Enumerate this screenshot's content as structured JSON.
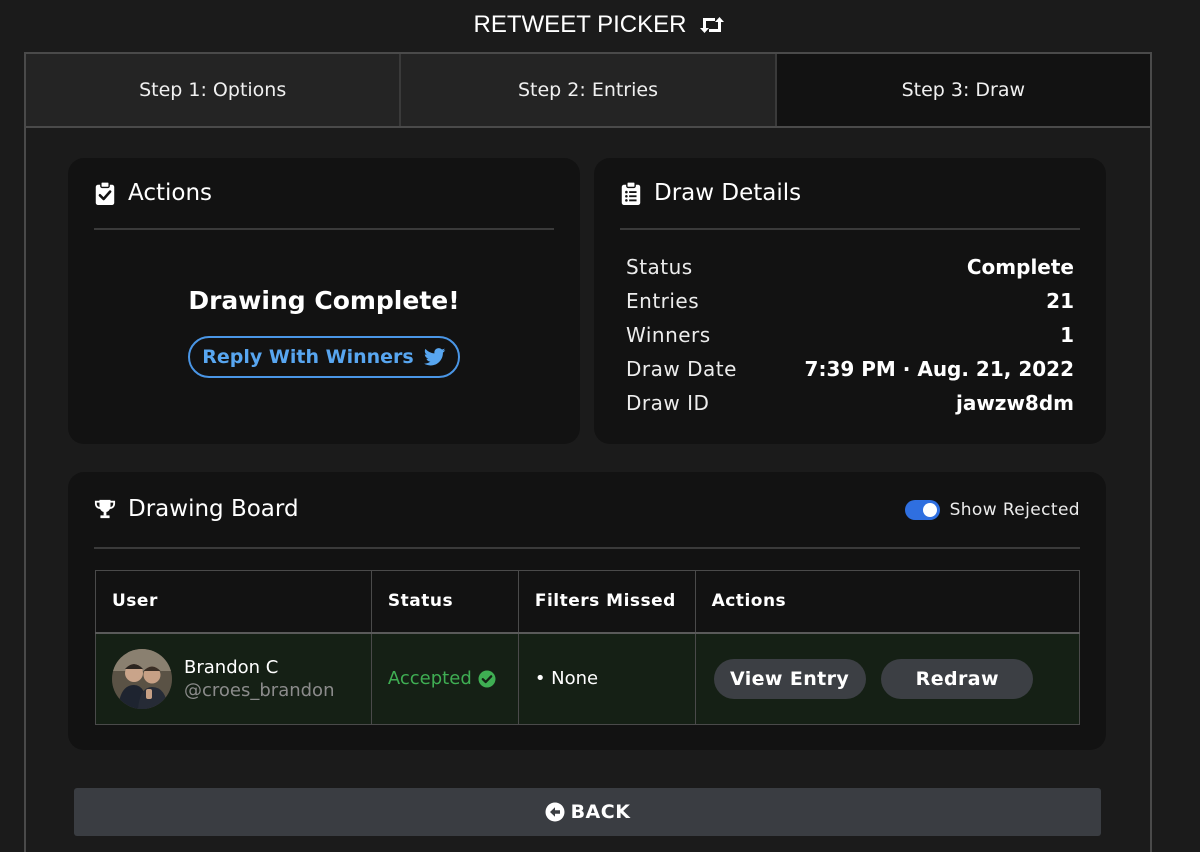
{
  "app": {
    "title": "RETWEET PICKER",
    "title_icon": "retweet-icon"
  },
  "tabs": [
    {
      "label": "Step 1: Options",
      "active": false
    },
    {
      "label": "Step 2: Entries",
      "active": false
    },
    {
      "label": "Step 3: Draw",
      "active": true
    }
  ],
  "actions_card": {
    "title": "Actions",
    "icon": "clipboard-check-icon",
    "status_text": "Drawing Complete!",
    "reply_button": "Reply With Winners",
    "reply_icon": "twitter-bird-icon"
  },
  "details_card": {
    "title": "Draw Details",
    "icon": "clipboard-list-icon",
    "rows": [
      {
        "label": "Status",
        "value": "Complete"
      },
      {
        "label": "Entries",
        "value": "21"
      },
      {
        "label": "Winners",
        "value": "1"
      },
      {
        "label": "Draw Date",
        "value": "7:39 PM · Aug. 21, 2022"
      },
      {
        "label": "Draw ID",
        "value": "jawzw8dm"
      }
    ]
  },
  "board_card": {
    "title": "Drawing Board",
    "icon": "trophy-icon",
    "toggle_label": "Show Rejected",
    "toggle_on": true,
    "columns": [
      "User",
      "Status",
      "Filters Missed",
      "Actions"
    ],
    "rows": [
      {
        "name": "Brandon C",
        "handle": "@croes_brandon",
        "status": "Accepted",
        "filters_missed": "• None",
        "view_button": "View Entry",
        "redraw_button": "Redraw"
      }
    ]
  },
  "back_button": "BACK",
  "colors": {
    "background": "#1b1b1b",
    "card": "#121212",
    "accent_blue": "#4a96e6",
    "accepted_green": "#3fae53",
    "button_gray": "#3c3f44"
  }
}
